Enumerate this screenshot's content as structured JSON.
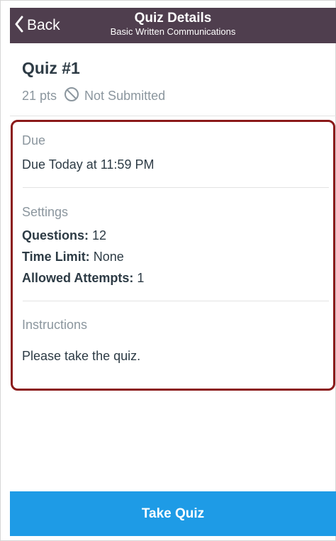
{
  "navbar": {
    "back_label": "Back",
    "title": "Quiz Details",
    "subtitle": "Basic Written Communications"
  },
  "quiz": {
    "title": "Quiz #1",
    "points": "21 pts",
    "status": "Not Submitted"
  },
  "details": {
    "due_label": "Due",
    "due_value": "Due Today at 11:59 PM",
    "settings_label": "Settings",
    "questions_label": "Questions:",
    "questions_value": "12",
    "time_limit_label": "Time Limit:",
    "time_limit_value": "None",
    "attempts_label": "Allowed Attempts:",
    "attempts_value": "1",
    "instructions_label": "Instructions",
    "instructions_value": "Please take the quiz."
  },
  "footer": {
    "take_quiz_label": "Take Quiz"
  },
  "colors": {
    "navbar": "#4f3e4e",
    "highlight_border": "#8b1a1a",
    "primary_button": "#1e9be6",
    "text_dark": "#2d3b45",
    "text_muted": "#8b969e"
  },
  "icons": {
    "back": "chevron-left-icon",
    "status": "no-entry-icon"
  }
}
